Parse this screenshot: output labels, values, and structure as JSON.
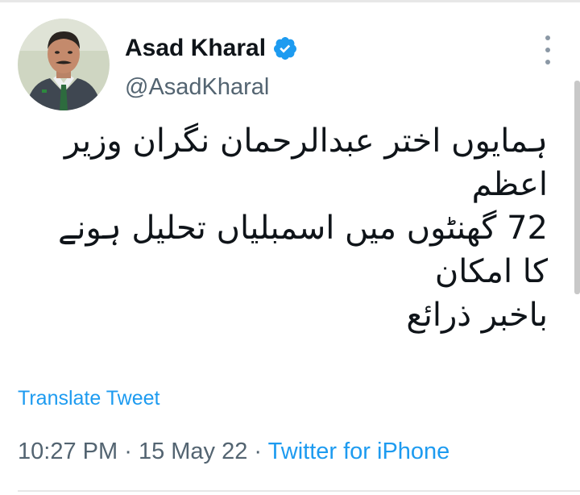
{
  "tweet": {
    "author": {
      "display_name": "Asad Kharal",
      "handle": "@AsadKharal",
      "verified": true
    },
    "text_lines": [
      "ہمایوں اختر عبدالرحمان نگران وزیر",
      "اعظم",
      "72 گھنٹوں میں اسمبلیاں تحلیل ہونے",
      "کا امکان",
      "باخبر ذرائع"
    ],
    "translate_label": "Translate Tweet",
    "time": "10:27 PM",
    "date": "15 May 22",
    "separator": "·",
    "source": "Twitter for iPhone"
  },
  "icons": {
    "verified": "verified-badge-icon",
    "more": "more-vertical-icon"
  },
  "colors": {
    "link_blue": "#1d9bf0",
    "secondary_text": "#536471",
    "primary_text": "#0f1419"
  }
}
